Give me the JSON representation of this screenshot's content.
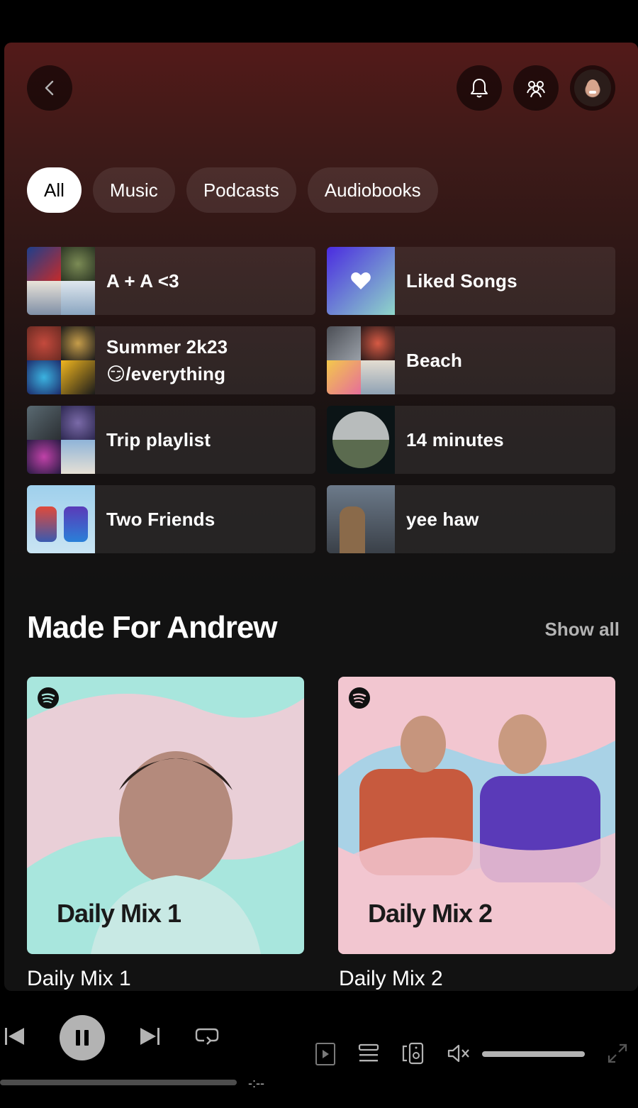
{
  "filters": [
    "All",
    "Music",
    "Podcasts",
    "Audiobooks"
  ],
  "shortcuts": [
    {
      "title": "A + A <3"
    },
    {
      "title": "Liked Songs"
    },
    {
      "title": "Summer 2k23",
      "title2": "😏/everything"
    },
    {
      "title": "Beach"
    },
    {
      "title": "Trip playlist"
    },
    {
      "title": "14 minutes"
    },
    {
      "title": "Two Friends"
    },
    {
      "title": "yee haw"
    }
  ],
  "section": {
    "title": "Made For Andrew",
    "show_all": "Show all"
  },
  "mixes": [
    {
      "cover_text": "Daily Mix 1",
      "caption": "Daily Mix 1",
      "bg": "#a8e6dd"
    },
    {
      "cover_text": "Daily Mix 2",
      "caption": "Daily Mix 2",
      "bg": "#f2c6d0"
    }
  ],
  "player": {
    "time_remaining": "-:--"
  },
  "colors": {
    "accent": "#531a19",
    "liked_songs_gradient": [
      "#4a2be0",
      "#8fd6c9"
    ]
  }
}
